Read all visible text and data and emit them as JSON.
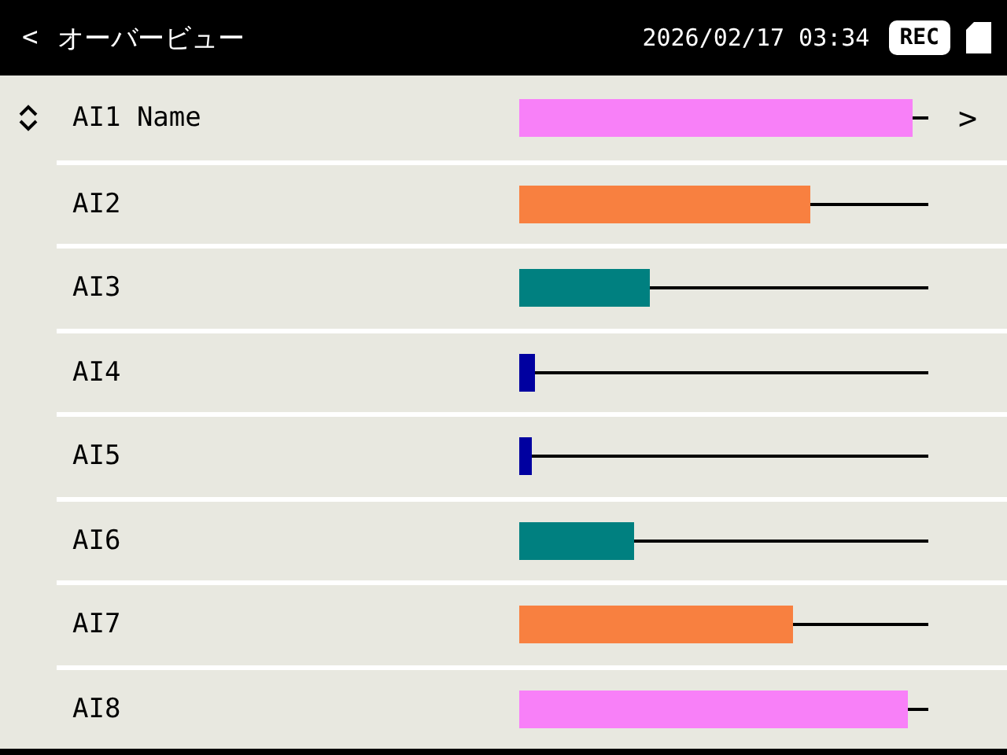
{
  "header": {
    "back": "<",
    "title": "オーバービュー",
    "datetime": "2026/02/17 03:34",
    "rec": "REC"
  },
  "row_arrow": ">",
  "channels": [
    {
      "name": "AI1 Name",
      "selected": true,
      "level": 0.96,
      "color": "#f880f8"
    },
    {
      "name": "AI2",
      "selected": false,
      "level": 0.71,
      "color": "#f88040"
    },
    {
      "name": "AI3",
      "selected": false,
      "level": 0.32,
      "color": "#008080"
    },
    {
      "name": "AI4",
      "selected": false,
      "level": 0.04,
      "color": "#0000a0"
    },
    {
      "name": "AI5",
      "selected": false,
      "level": 0.03,
      "color": "#0000a0"
    },
    {
      "name": "AI6",
      "selected": false,
      "level": 0.28,
      "color": "#008080"
    },
    {
      "name": "AI7",
      "selected": false,
      "level": 0.67,
      "color": "#f88040"
    },
    {
      "name": "AI8",
      "selected": false,
      "level": 0.95,
      "color": "#f880f8"
    }
  ]
}
